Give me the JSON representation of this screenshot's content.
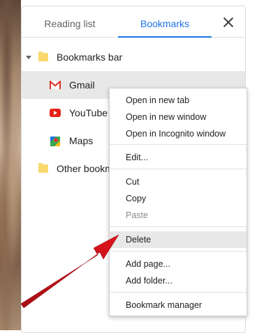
{
  "tabs": {
    "reading_list": "Reading list",
    "bookmarks": "Bookmarks"
  },
  "tree": {
    "bookmarks_bar": "Bookmarks bar",
    "items": [
      {
        "label": "Gmail",
        "icon": "gmail-icon"
      },
      {
        "label": "YouTube",
        "icon": "youtube-icon"
      },
      {
        "label": "Maps",
        "icon": "maps-icon"
      }
    ],
    "other_bookmarks": "Other bookm"
  },
  "context_menu": {
    "open_new_tab": "Open in new tab",
    "open_new_window": "Open in new window",
    "open_incognito": "Open in Incognito window",
    "edit": "Edit...",
    "cut": "Cut",
    "copy": "Copy",
    "paste": "Paste",
    "delete": "Delete",
    "add_page": "Add page...",
    "add_folder": "Add folder...",
    "bookmark_manager": "Bookmark manager"
  },
  "colors": {
    "accent": "#1a73e8",
    "folder": "#f9d86d",
    "annotation_arrow": "#c8101a"
  }
}
